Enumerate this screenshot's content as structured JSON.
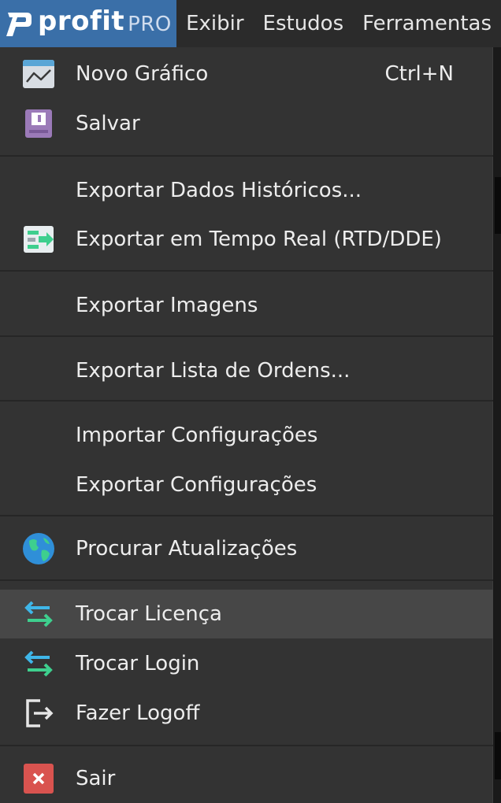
{
  "menubar": {
    "logo": {
      "wordmark": "profit",
      "suffix": "PRO",
      "accent_color": "#3a6fa8"
    },
    "items": [
      {
        "label": "Exibir"
      },
      {
        "label": "Estudos"
      },
      {
        "label": "Ferramentas"
      }
    ]
  },
  "dropdown": {
    "items": [
      {
        "label": "Novo Gráfico",
        "shortcut": "Ctrl+N",
        "icon": "chart-line-icon"
      },
      {
        "label": "Salvar",
        "icon": "save-icon"
      },
      {
        "label": "Exportar Dados Históricos..."
      },
      {
        "label": "Exportar em Tempo Real (RTD/DDE)",
        "icon": "export-realtime-icon"
      },
      {
        "label": "Exportar Imagens"
      },
      {
        "label": "Exportar Lista de Ordens..."
      },
      {
        "label": "Importar Configurações"
      },
      {
        "label": "Exportar Configurações"
      },
      {
        "label": "Procurar Atualizações",
        "icon": "globe-icon"
      },
      {
        "label": "Trocar Licença",
        "icon": "swap-arrows-icon",
        "highlighted": true
      },
      {
        "label": "Trocar Login",
        "icon": "swap-arrows-icon"
      },
      {
        "label": "Fazer Logoff",
        "icon": "logoff-icon"
      },
      {
        "label": "Sair",
        "icon": "close-icon"
      }
    ]
  },
  "colors": {
    "menu_background": "#333333",
    "menu_hover": "#474747",
    "text": "#ededed",
    "exit_red": "#d9534f",
    "swap_cyan": "#3fb6e8",
    "swap_green": "#3ecf8e"
  }
}
